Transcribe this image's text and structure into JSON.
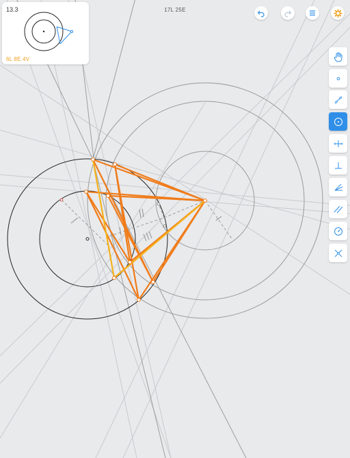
{
  "goal": {
    "level": "13.3",
    "score": "6L 8E 4V"
  },
  "move_counter": "17L 25E",
  "top_buttons": [
    {
      "name": "undo-button",
      "icon": "undo-arrow-icon"
    },
    {
      "name": "redo-button",
      "icon": "redo-arrow-icon"
    },
    {
      "name": "menu-button",
      "icon": "hamburger-menu-icon"
    },
    {
      "name": "settings-button",
      "icon": "gear-icon"
    }
  ],
  "tools": [
    {
      "name": "tool-move",
      "icon": "hand-icon",
      "active": false
    },
    {
      "name": "tool-point",
      "icon": "point-icon",
      "active": false
    },
    {
      "name": "tool-line",
      "icon": "line-icon",
      "active": false
    },
    {
      "name": "tool-circle",
      "icon": "circle-icon",
      "active": true
    },
    {
      "name": "tool-perpendicular-bisector",
      "icon": "perpendicular-bisector-icon",
      "active": false
    },
    {
      "name": "tool-perpendicular",
      "icon": "perpendicular-icon",
      "active": false
    },
    {
      "name": "tool-angle-bisector",
      "icon": "angle-bisector-icon",
      "active": false
    },
    {
      "name": "tool-parallel",
      "icon": "parallel-icon",
      "active": false
    },
    {
      "name": "tool-compass",
      "icon": "compass-icon",
      "active": false
    },
    {
      "name": "tool-intersect",
      "icon": "intersect-icon",
      "active": false
    }
  ],
  "colors": {
    "background": "#e9eaec",
    "accent_blue": "#2f8fe8",
    "construction_gray": "#9a9a9a",
    "solution_orange": "#f07c1a",
    "solution_yellow": "#f5b21b",
    "given_black": "#222222",
    "score_orange": "#f0a020"
  }
}
